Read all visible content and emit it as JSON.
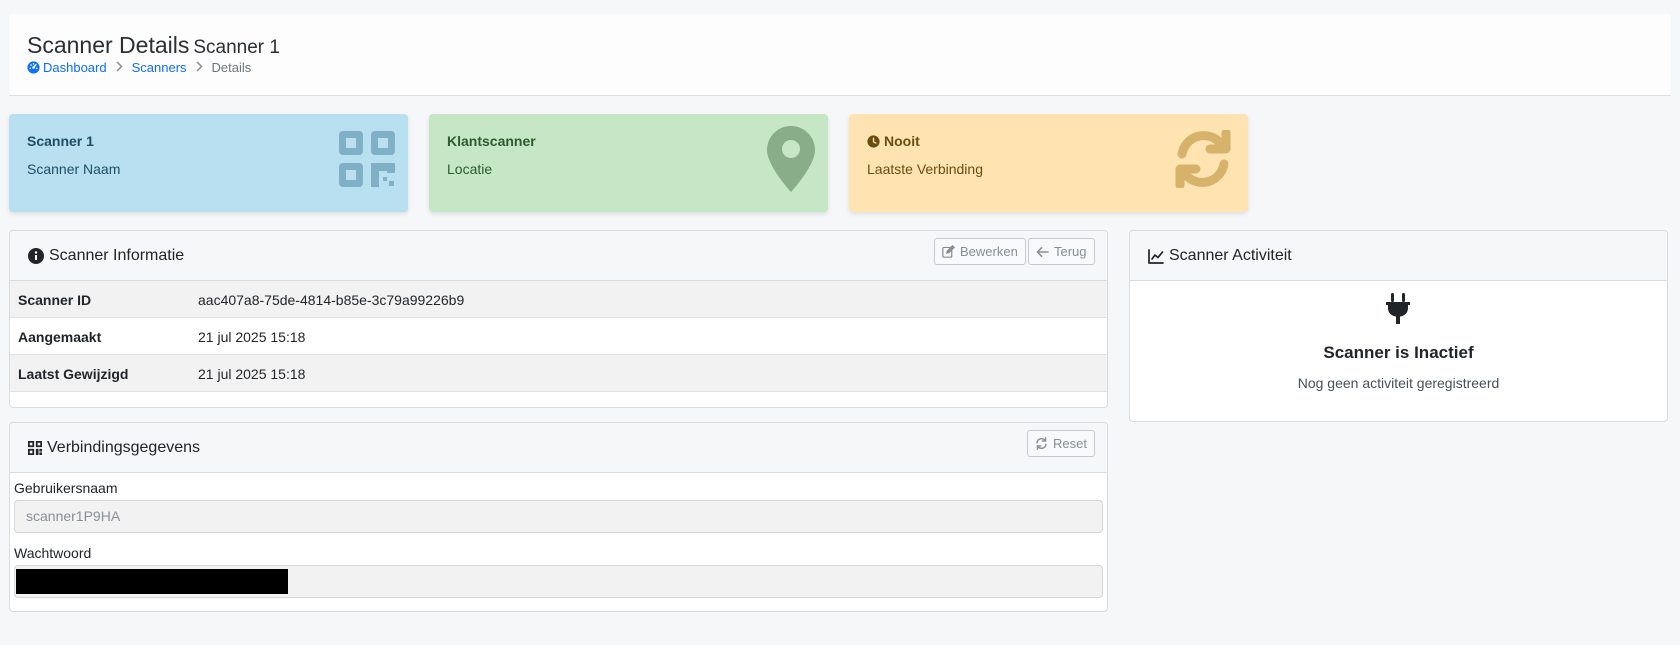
{
  "header": {
    "title": "Scanner Details",
    "subtitle": "Scanner 1",
    "breadcrumb": {
      "dashboard": "Dashboard",
      "scanners": "Scanners",
      "current": "Details"
    }
  },
  "stats": [
    {
      "value": "Scanner 1",
      "label": "Scanner Naam",
      "icon": "qrcode-icon",
      "color": "#b8e0f1"
    },
    {
      "value": "Klantscanner",
      "label": "Locatie",
      "icon": "map-pin-icon",
      "color": "#c5e7c5"
    },
    {
      "value": "Nooit",
      "label": "Laatste Verbinding",
      "icon": "sync-icon",
      "color": "#ffe3b0"
    }
  ],
  "info": {
    "title": "Scanner Informatie",
    "edit_label": "Bewerken",
    "back_label": "Terug",
    "rows": [
      {
        "label": "Scanner ID",
        "value": "aac407a8-75de-4814-b85e-3c79a99226b9"
      },
      {
        "label": "Aangemaakt",
        "value": "21 jul 2025 15:18"
      },
      {
        "label": "Laatst Gewijzigd",
        "value": "21 jul 2025 15:18"
      }
    ]
  },
  "connection": {
    "title": "Verbindingsgegevens",
    "reset_label": "Reset",
    "username_label": "Gebruikersnaam",
    "username_value": "scanner1P9HA",
    "password_label": "Wachtwoord"
  },
  "activity": {
    "title": "Scanner Activiteit",
    "status_title": "Scanner is Inactief",
    "status_sub": "Nog geen activiteit geregistreerd"
  },
  "colors": {
    "link": "#0d6efd",
    "info_blue": "#b8e0f1",
    "success_green": "#c5e7c5",
    "warning_yellow": "#ffe3b0"
  }
}
